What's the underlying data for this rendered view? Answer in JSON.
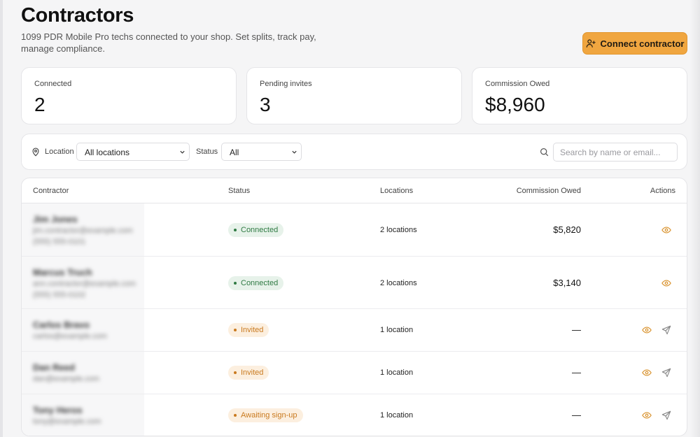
{
  "header": {
    "title": "Contractors",
    "subtitle": "1099 PDR Mobile Pro techs connected to your shop. Set splits, track pay, manage compliance.",
    "connect_label": "Connect contractor"
  },
  "stats": [
    {
      "label": "Connected",
      "value": "2"
    },
    {
      "label": "Pending invites",
      "value": "3"
    },
    {
      "label": "Commission Owed",
      "value": "$8,960"
    }
  ],
  "filters": {
    "location_label": "Location",
    "location_value": "All locations",
    "status_label": "Status",
    "status_value": "All",
    "search_placeholder": "Search by name or email..."
  },
  "table": {
    "columns": [
      "Contractor",
      "Status",
      "Locations",
      "Commission Owed",
      "Actions"
    ],
    "rows": [
      {
        "name": "Jim Jones",
        "email": "jim.contractor@example.com",
        "phone": "(555) 555-0101",
        "status": "Connected",
        "locations": "2 locations",
        "owed": "$5,820",
        "can_resend": false
      },
      {
        "name": "Marcus Truch",
        "email": "ann.contractor@example.com",
        "phone": "(555) 555-0102",
        "status": "Connected",
        "locations": "2 locations",
        "owed": "$3,140",
        "can_resend": false
      },
      {
        "name": "Carlos Bravo",
        "email": "carlos@example.com",
        "phone": "",
        "status": "Invited",
        "locations": "1 location",
        "owed": "—",
        "can_resend": true
      },
      {
        "name": "Dan Reed",
        "email": "dan@example.com",
        "phone": "",
        "status": "Invited",
        "locations": "1 location",
        "owed": "—",
        "can_resend": true
      },
      {
        "name": "Tony Heros",
        "email": "tony@example.com",
        "phone": "",
        "status": "Awaiting sign-up",
        "locations": "1 location",
        "owed": "—",
        "can_resend": true
      }
    ]
  },
  "colors": {
    "accent": "#f0a640",
    "connected_badge_bg": "#e7f2ea",
    "connected_badge_text": "#2f7a43",
    "pending_badge_bg": "#fcefdf",
    "pending_badge_text": "#c97a1f",
    "eye_icon": "#d9932f"
  },
  "icons": {
    "connect_button": "user-plus-icon",
    "location_filter": "map-pin-icon",
    "search": "search-icon",
    "view_action": "eye-icon",
    "resend_action": "send-icon",
    "select_caret": "chevron-down-icon"
  }
}
